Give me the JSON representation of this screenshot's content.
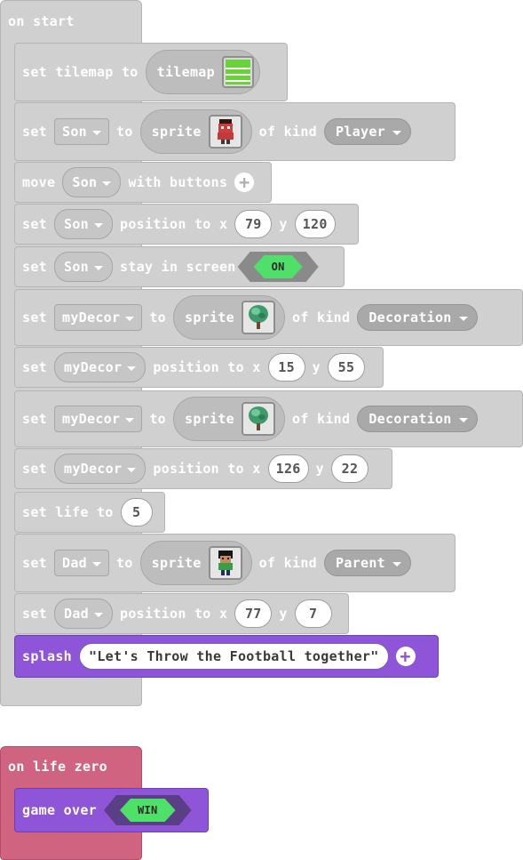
{
  "on_start": {
    "label": "on start",
    "blocks": {
      "tilemap": {
        "set": "set tilemap to",
        "pill": "tilemap",
        "icon": "tilemap-icon"
      },
      "son_sprite": {
        "set": "set",
        "var": "Son",
        "to": "to",
        "sprite": "sprite",
        "of_kind": "of kind",
        "kind": "Player",
        "icon": "son-sprite-icon"
      },
      "move": {
        "move": "move",
        "var": "Son",
        "with": "with buttons"
      },
      "son_pos": {
        "set": "set",
        "var": "Son",
        "pos": "position to x",
        "x": "79",
        "y_label": "y",
        "y": "120"
      },
      "son_stay": {
        "set": "set",
        "var": "Son",
        "stay": "stay in screen",
        "toggle": "ON"
      },
      "decor1": {
        "set": "set",
        "var": "myDecor",
        "to": "to",
        "sprite": "sprite",
        "of_kind": "of kind",
        "kind": "Decoration",
        "icon": "tree-icon"
      },
      "decor1_pos": {
        "set": "set",
        "var": "myDecor",
        "pos": "position to x",
        "x": "15",
        "y_label": "y",
        "y": "55"
      },
      "decor2": {
        "set": "set",
        "var": "myDecor",
        "to": "to",
        "sprite": "sprite",
        "of_kind": "of kind",
        "kind": "Decoration",
        "icon": "tree-icon"
      },
      "decor2_pos": {
        "set": "set",
        "var": "myDecor",
        "pos": "position to x",
        "x": "126",
        "y_label": "y",
        "y": "22"
      },
      "life": {
        "set": "set life to",
        "value": "5"
      },
      "dad": {
        "set": "set",
        "var": "Dad",
        "to": "to",
        "sprite": "sprite",
        "of_kind": "of kind",
        "kind": "Parent",
        "icon": "dad-sprite-icon"
      },
      "dad_pos": {
        "set": "set",
        "var": "Dad",
        "pos": "position to x",
        "x": "77",
        "y_label": "y",
        "y": "7"
      },
      "splash": {
        "label": "splash",
        "text": "\"Let's Throw the Football together\""
      }
    }
  },
  "on_life_zero": {
    "label": "on life zero",
    "game_over": {
      "label": "game over",
      "toggle": "WIN"
    }
  },
  "colors": {
    "block_gray": "#d0d0d0",
    "block_purple": "#8e55d8",
    "hat_red": "#cf6380",
    "toggle_green": "#4fe06a"
  }
}
